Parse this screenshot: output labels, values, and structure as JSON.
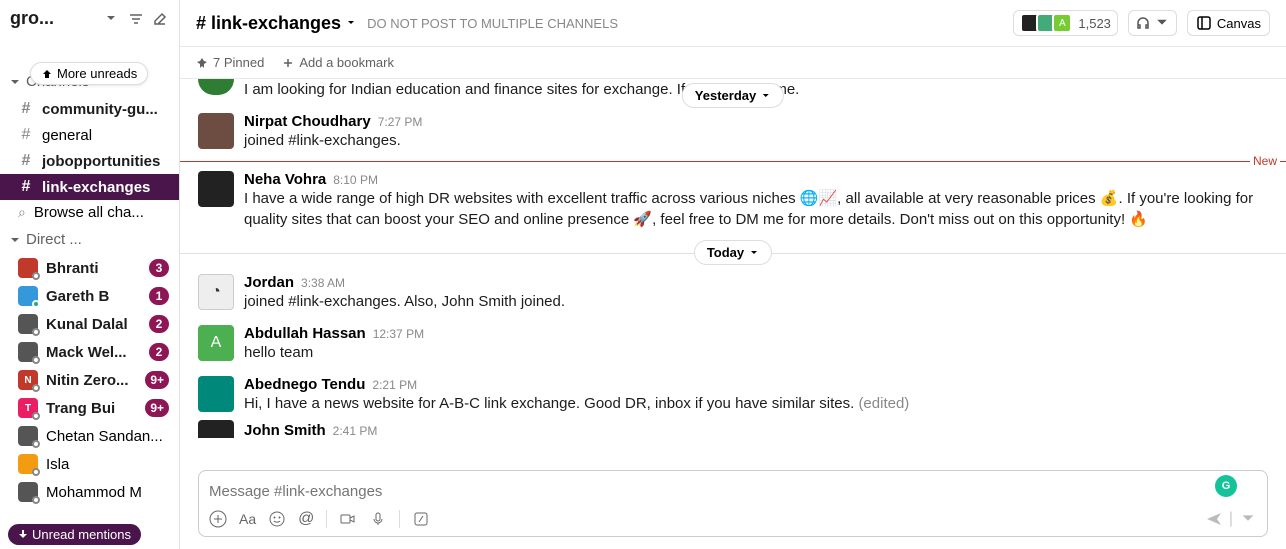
{
  "sidebar": {
    "workspace": "gro...",
    "more_unreads": "More unreads",
    "channels_label": "Channels",
    "channels": [
      {
        "name": "community-gu...",
        "bold": true
      },
      {
        "name": "general",
        "bold": false
      },
      {
        "name": "jobopportunities",
        "bold": true
      },
      {
        "name": "link-exchanges",
        "bold": true,
        "selected": true
      }
    ],
    "browse": "Browse all cha...",
    "dm_label": "Direct ...",
    "dms": [
      {
        "name": "Bhranti",
        "badge": "3",
        "bold": true,
        "av": "red"
      },
      {
        "name": "Gareth B",
        "badge": "1",
        "bold": true,
        "av": "blue",
        "online": true
      },
      {
        "name": "Kunal Dalal",
        "badge": "2",
        "bold": true,
        "av": "dark"
      },
      {
        "name": "Mack Wel...",
        "badge": "2",
        "bold": true,
        "av": "dark"
      },
      {
        "name": "Nitin Zero...",
        "badge": "9+",
        "bold": true,
        "av": "red",
        "letter": "N"
      },
      {
        "name": "Trang Bui",
        "badge": "9+",
        "bold": true,
        "av": "pink",
        "letter": "T"
      },
      {
        "name": "Chetan Sandan...",
        "bold": false,
        "av": "dark"
      },
      {
        "name": "Isla",
        "bold": false,
        "av": "yellow"
      },
      {
        "name": "Mohammod M",
        "bold": false,
        "av": "dark"
      }
    ],
    "unread_mentions": "Unread mentions"
  },
  "header": {
    "channel": "# link-exchanges",
    "topic": "DO NOT POST TO MULTIPLE CHANNELS",
    "member_count": "1,523",
    "canvas": "Canvas",
    "avatar_letter": "A"
  },
  "bookmarks": {
    "pinned": "7 Pinned",
    "add": "Add a bookmark"
  },
  "dividers": {
    "yesterday": "Yesterday",
    "today": "Today",
    "new": "New"
  },
  "messages": {
    "m0": {
      "text": "I am looking for Indian education and finance sites for exchange. If an                  ease DM me."
    },
    "m1": {
      "name": "Nirpat Choudhary",
      "time": "7:27 PM",
      "text": "joined #link-exchanges."
    },
    "m2": {
      "name": "Neha Vohra",
      "time": "8:10 PM",
      "text": "I have a wide range of high DR websites with excellent traffic across various niches 🌐📈, all available at very reasonable prices 💰. If you're looking for quality sites that can boost your SEO and online presence 🚀, feel free to DM me for more details. Don't miss out on this opportunity! 🔥"
    },
    "m3": {
      "name": "Jordan",
      "time": "3:38 AM",
      "text": "joined #link-exchanges. Also, John Smith joined."
    },
    "m4": {
      "name": "Abdullah Hassan",
      "time": "12:37 PM",
      "text": "hello team",
      "letter": "A"
    },
    "m5": {
      "name": "Abednego Tendu",
      "time": "2:21 PM",
      "text": "Hi, I have a news website for A-B-C link exchange. Good DR, inbox if you have similar sites. ",
      "edited": "(edited)"
    },
    "m6": {
      "name": "John Smith",
      "time": "2:41 PM"
    }
  },
  "composer": {
    "placeholder": "Message #link-exchanges"
  }
}
